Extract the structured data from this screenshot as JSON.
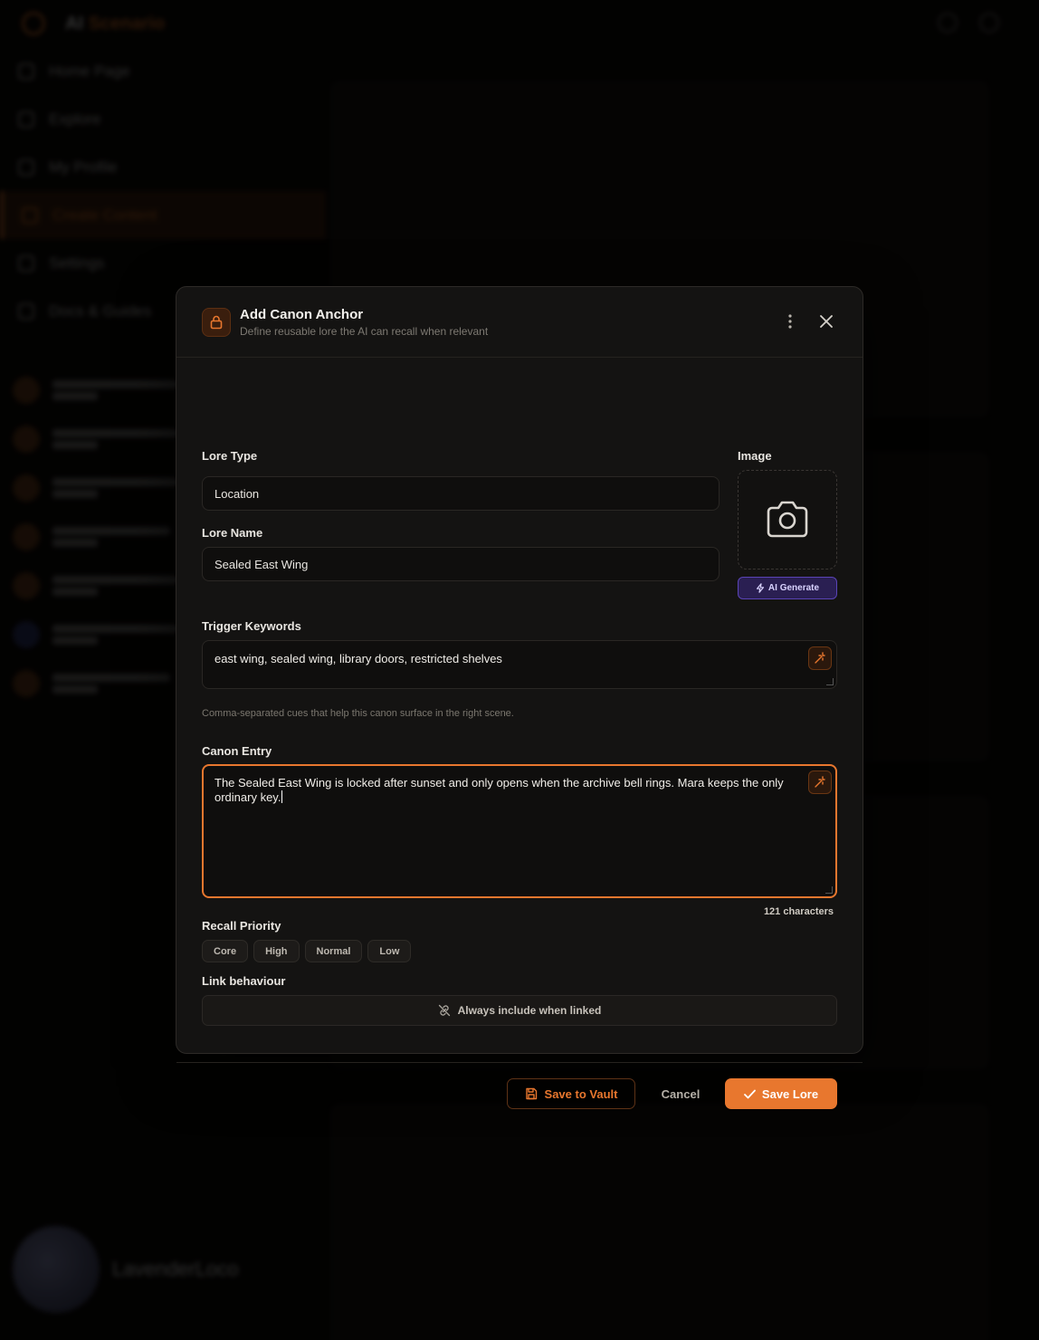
{
  "background": {
    "brand_prefix": "AI",
    "brand_suffix": "Scenario",
    "nav": [
      "Home Page",
      "Explore",
      "My Profile",
      "Create Content",
      "Settings",
      "Docs & Guides"
    ],
    "active_nav_index": 3,
    "username": "LavenderLoco"
  },
  "modal": {
    "title": "Add Canon Anchor",
    "subtitle": "Define reusable lore the AI can recall when relevant",
    "lore_type": {
      "label": "Lore Type",
      "value": "Location"
    },
    "lore_name": {
      "label": "Lore Name",
      "value": "Sealed East Wing"
    },
    "image": {
      "label": "Image",
      "ai_generate_label": "AI Generate"
    },
    "trigger_keywords": {
      "label": "Trigger Keywords",
      "value": "east wing, sealed wing, library doors, restricted shelves",
      "hint": "Comma-separated cues that help this canon surface in the right scene."
    },
    "canon_entry": {
      "label": "Canon Entry",
      "value": "The Sealed East Wing is locked after sunset and only opens when the archive bell rings. Mara keeps the only ordinary key.",
      "char_count": "121 characters"
    },
    "recall_priority": {
      "label": "Recall Priority",
      "options": [
        "Core",
        "High",
        "Normal",
        "Low"
      ]
    },
    "link_behaviour": {
      "label": "Link behaviour",
      "value": "Always include when linked"
    },
    "footer": {
      "save_vault": "Save to Vault",
      "cancel": "Cancel",
      "save_lore": "Save Lore"
    }
  },
  "colors": {
    "accent": "#e8772e",
    "ai_purple": "#5a44b6",
    "modal_bg": "#141312"
  }
}
